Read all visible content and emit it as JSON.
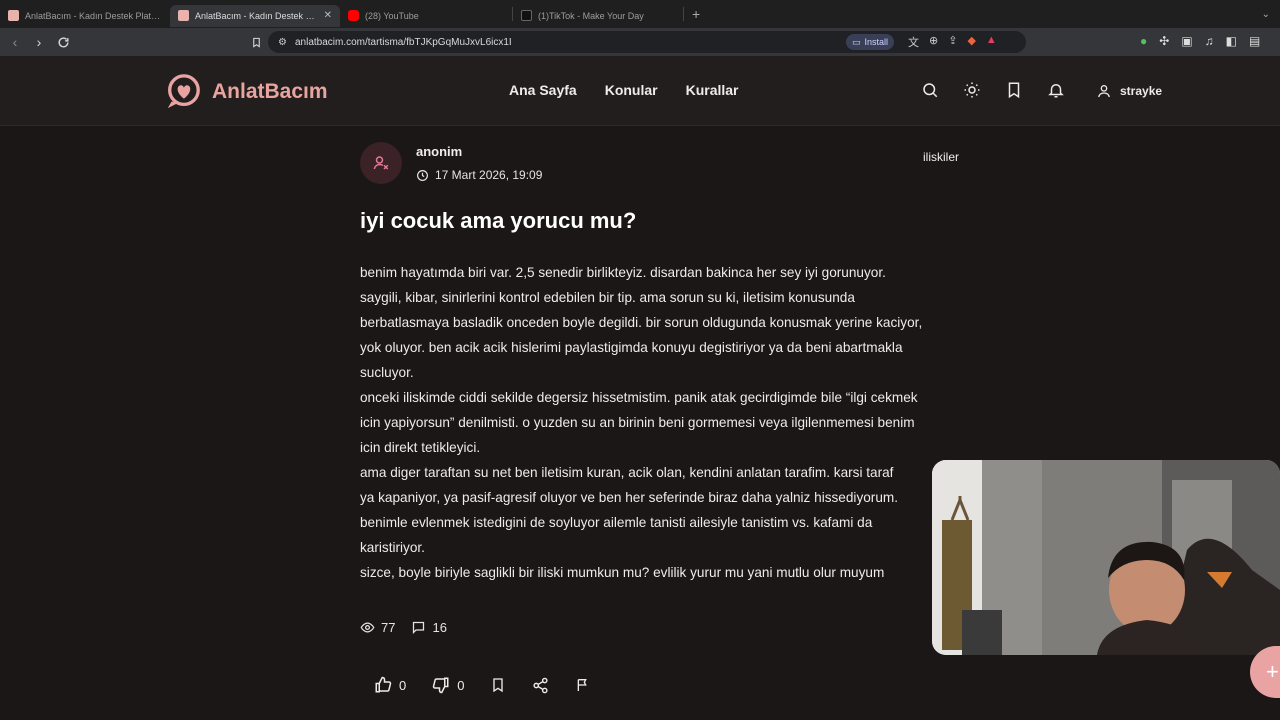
{
  "browser": {
    "tabs": [
      {
        "title": "AnlatBacım - Kadın Destek Platformu",
        "favicon_color": "#e9b3ad",
        "active": false
      },
      {
        "title": "AnlatBacım - Kadın Destek Platformu",
        "favicon_color": "#e9b3ad",
        "active": true
      },
      {
        "title": "(28) YouTube",
        "favicon_color": "#ff0000",
        "active": false
      },
      {
        "title": "(1)TikTok - Make Your Day",
        "favicon_color": "#111111",
        "active": false
      }
    ],
    "new_tab_label": "+",
    "url": "anlatbacim.com/tartisma/fbTJKpGqMuJxvL6icx1I",
    "install_label": "Install"
  },
  "site": {
    "logo_text": "AnlatBacım",
    "brand_color": "#e9a3a2",
    "nav": [
      "Ana Sayfa",
      "Konular",
      "Kurallar"
    ],
    "icons": [
      "search-icon",
      "theme-icon",
      "bookmark-icon",
      "bell-icon"
    ],
    "username": "strayke"
  },
  "post": {
    "author": "anonim",
    "date": "17 Mart 2026, 19:09",
    "category": "iliskiler",
    "title": "iyi cocuk ama yorucu mu?",
    "body_lines": [
      "benim hayatımda biri var. 2,5 senedir birlikteyiz. disardan bakinca her sey iyi gorunuyor.",
      "saygili, kibar, sinirlerini kontrol edebilen bir tip. ama sorun su ki, iletisim konusunda",
      "berbatlasmaya basladik onceden boyle degildi. bir sorun oldugunda konusmak yerine kaciyor,",
      "yok oluyor. ben acik acik hislerimi paylastigimda konuyu degistiriyor ya da beni abartmakla",
      "sucluyor.",
      "onceki iliskimde ciddi sekilde degersiz hissetmistim. panik atak gecirdigimde bile “ilgi cekmek",
      "icin yapiyorsun” denilmisti. o yuzden su an birinin beni gormemesi veya ilgilenmemesi benim",
      "icin direkt tetikleyici.",
      "ama diger taraftan su net ben iletisim kuran, acik olan, kendini anlatan tarafim. karsi taraf",
      "ya kapaniyor, ya pasif-agresif oluyor ve ben her seferinde biraz daha yalniz hissediyorum.",
      "benimle evlenmek istedigini de soyluyor ailemle tanisti ailesiyle tanistim vs. kafami da",
      "karistiriyor.",
      "sizce, boyle biriyle saglikli bir iliski mumkun mu? evlilik yurur mu yani mutlu olur muyum"
    ],
    "views": "77",
    "comments": "16",
    "likes": "0",
    "dislikes": "0"
  },
  "fab_label": "+"
}
